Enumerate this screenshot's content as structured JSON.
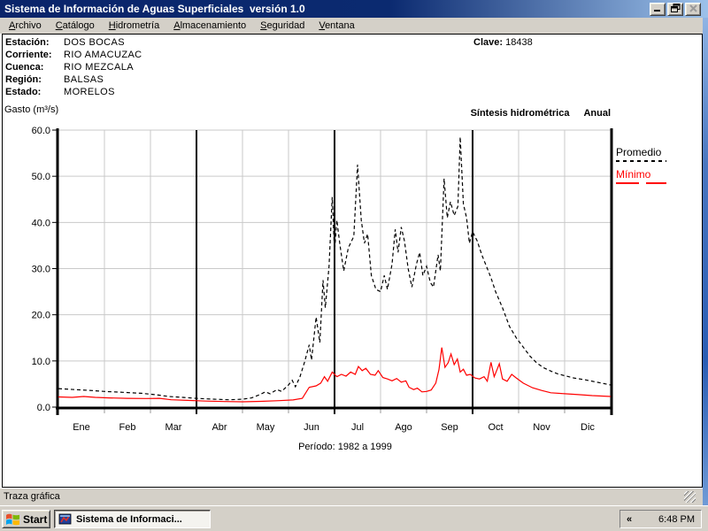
{
  "window": {
    "title": "Sistema de Información de Aguas Superficiales  versión 1.0"
  },
  "menu": {
    "items": [
      "Archivo",
      "Catálogo",
      "Hidrometría",
      "Almacenamiento",
      "Seguridad",
      "Ventana"
    ]
  },
  "station": {
    "fields": [
      {
        "label": "Estación:",
        "value": "DOS BOCAS"
      },
      {
        "label": "Corriente:",
        "value": "RIO AMACUZAC"
      },
      {
        "label": "Cuenca:",
        "value": "RIO MEZCALA"
      },
      {
        "label": "Región:",
        "value": "BALSAS"
      },
      {
        "label": "Estado:",
        "value": "MORELOS"
      }
    ],
    "clave_label": "Clave:",
    "clave_value": "18438"
  },
  "chart": {
    "ylabel": "Gasto (m³/s)",
    "title": "Síntesis hidrométrica",
    "subtitle": "Anual",
    "caption": "Período: 1982 a 1999"
  },
  "chart_data": {
    "type": "line",
    "title": "Síntesis hidrométrica Anual",
    "ylabel": "Gasto (m³/s)",
    "xlabel": "",
    "caption": "Período: 1982 a 1999",
    "categories": [
      "Ene",
      "Feb",
      "Mar",
      "Abr",
      "May",
      "Jun",
      "Jul",
      "Ago",
      "Sep",
      "Oct",
      "Nov",
      "Dic"
    ],
    "ylim": [
      0,
      60
    ],
    "ytick_step": 10,
    "ytick_labels": [
      "0.0",
      "10.0",
      "20.0",
      "30.0",
      "40.0",
      "50.0",
      "60.0"
    ],
    "grid": true,
    "quarter_divider_months": [
      3,
      6,
      9
    ],
    "legend_position": "right",
    "x_units": "month fraction 0-12",
    "series": [
      {
        "name": "Promedio",
        "color": "#000000",
        "style": "dashed",
        "points": [
          [
            0,
            4.0
          ],
          [
            0.35,
            3.8
          ],
          [
            0.7,
            3.6
          ],
          [
            1.0,
            3.4
          ],
          [
            1.4,
            3.2
          ],
          [
            1.8,
            3.0
          ],
          [
            2.1,
            2.7
          ],
          [
            2.4,
            2.3
          ],
          [
            2.7,
            2.1
          ],
          [
            3.0,
            1.9
          ],
          [
            3.3,
            1.75
          ],
          [
            3.7,
            1.6
          ],
          [
            4.0,
            1.7
          ],
          [
            4.2,
            2.0
          ],
          [
            4.35,
            2.6
          ],
          [
            4.5,
            3.3
          ],
          [
            4.6,
            2.9
          ],
          [
            4.75,
            3.8
          ],
          [
            4.85,
            3.4
          ],
          [
            5.0,
            4.8
          ],
          [
            5.08,
            5.8
          ],
          [
            5.15,
            4.4
          ],
          [
            5.25,
            6.6
          ],
          [
            5.35,
            9.8
          ],
          [
            5.45,
            13.5
          ],
          [
            5.5,
            10.2
          ],
          [
            5.6,
            19.5
          ],
          [
            5.68,
            14.0
          ],
          [
            5.75,
            27.5
          ],
          [
            5.8,
            21.5
          ],
          [
            5.88,
            30.5
          ],
          [
            5.95,
            45.5
          ],
          [
            6.0,
            33.5
          ],
          [
            6.05,
            40.5
          ],
          [
            6.12,
            35.0
          ],
          [
            6.2,
            29.5
          ],
          [
            6.3,
            34.5
          ],
          [
            6.42,
            37.0
          ],
          [
            6.5,
            52.5
          ],
          [
            6.58,
            40.5
          ],
          [
            6.65,
            35.5
          ],
          [
            6.72,
            37.5
          ],
          [
            6.8,
            28.5
          ],
          [
            6.9,
            25.5
          ],
          [
            7.0,
            25.0
          ],
          [
            7.08,
            28.5
          ],
          [
            7.15,
            25.5
          ],
          [
            7.25,
            31.0
          ],
          [
            7.32,
            38.5
          ],
          [
            7.38,
            33.5
          ],
          [
            7.45,
            39.0
          ],
          [
            7.52,
            36.0
          ],
          [
            7.6,
            30.0
          ],
          [
            7.68,
            26.0
          ],
          [
            7.78,
            31.0
          ],
          [
            7.85,
            33.5
          ],
          [
            7.92,
            28.5
          ],
          [
            8.0,
            30.5
          ],
          [
            8.08,
            27.0
          ],
          [
            8.15,
            26.0
          ],
          [
            8.25,
            33.0
          ],
          [
            8.3,
            29.5
          ],
          [
            8.38,
            49.5
          ],
          [
            8.45,
            41.0
          ],
          [
            8.52,
            44.5
          ],
          [
            8.6,
            41.5
          ],
          [
            8.68,
            43.5
          ],
          [
            8.73,
            58.5
          ],
          [
            8.8,
            44.0
          ],
          [
            8.87,
            41.0
          ],
          [
            8.93,
            35.5
          ],
          [
            9.0,
            38.0
          ],
          [
            9.1,
            36.0
          ],
          [
            9.2,
            33.0
          ],
          [
            9.3,
            30.5
          ],
          [
            9.4,
            28.0
          ],
          [
            9.5,
            25.0
          ],
          [
            9.65,
            21.5
          ],
          [
            9.8,
            17.5
          ],
          [
            9.95,
            15.0
          ],
          [
            10.1,
            13.0
          ],
          [
            10.25,
            11.0
          ],
          [
            10.4,
            9.5
          ],
          [
            10.55,
            8.5
          ],
          [
            10.7,
            7.8
          ],
          [
            10.85,
            7.2
          ],
          [
            11.0,
            6.8
          ],
          [
            11.2,
            6.3
          ],
          [
            11.45,
            5.9
          ],
          [
            11.7,
            5.4
          ],
          [
            11.85,
            5.1
          ],
          [
            12,
            4.8
          ]
        ]
      },
      {
        "name": "Mínimo",
        "color": "#ff0000",
        "style": "solid",
        "points": [
          [
            0,
            2.2
          ],
          [
            0.3,
            2.1
          ],
          [
            0.55,
            2.3
          ],
          [
            0.8,
            2.1
          ],
          [
            1.1,
            2.0
          ],
          [
            1.5,
            1.9
          ],
          [
            1.9,
            1.85
          ],
          [
            2.2,
            1.9
          ],
          [
            2.45,
            1.6
          ],
          [
            2.8,
            1.45
          ],
          [
            3.2,
            1.3
          ],
          [
            3.6,
            1.2
          ],
          [
            4.0,
            1.15
          ],
          [
            4.4,
            1.25
          ],
          [
            4.8,
            1.4
          ],
          [
            5.1,
            1.55
          ],
          [
            5.3,
            1.9
          ],
          [
            5.45,
            4.3
          ],
          [
            5.6,
            4.6
          ],
          [
            5.7,
            5.2
          ],
          [
            5.78,
            6.6
          ],
          [
            5.85,
            5.6
          ],
          [
            5.95,
            7.6
          ],
          [
            6.05,
            6.6
          ],
          [
            6.15,
            7.1
          ],
          [
            6.25,
            6.7
          ],
          [
            6.35,
            7.6
          ],
          [
            6.45,
            7.1
          ],
          [
            6.52,
            8.8
          ],
          [
            6.6,
            7.9
          ],
          [
            6.68,
            8.4
          ],
          [
            6.78,
            7.1
          ],
          [
            6.88,
            6.9
          ],
          [
            6.95,
            7.9
          ],
          [
            7.05,
            6.4
          ],
          [
            7.15,
            6.1
          ],
          [
            7.25,
            5.7
          ],
          [
            7.35,
            6.2
          ],
          [
            7.45,
            5.4
          ],
          [
            7.55,
            5.7
          ],
          [
            7.62,
            4.3
          ],
          [
            7.72,
            3.8
          ],
          [
            7.8,
            4.1
          ],
          [
            7.9,
            3.3
          ],
          [
            8.0,
            3.4
          ],
          [
            8.1,
            3.7
          ],
          [
            8.2,
            5.2
          ],
          [
            8.27,
            8.1
          ],
          [
            8.33,
            12.9
          ],
          [
            8.4,
            8.6
          ],
          [
            8.47,
            9.6
          ],
          [
            8.53,
            11.5
          ],
          [
            8.6,
            9.2
          ],
          [
            8.67,
            10.4
          ],
          [
            8.73,
            7.6
          ],
          [
            8.8,
            8.2
          ],
          [
            8.87,
            6.9
          ],
          [
            8.95,
            7.1
          ],
          [
            9.05,
            6.3
          ],
          [
            9.15,
            6.1
          ],
          [
            9.25,
            6.6
          ],
          [
            9.32,
            5.6
          ],
          [
            9.4,
            9.7
          ],
          [
            9.47,
            6.6
          ],
          [
            9.53,
            8.1
          ],
          [
            9.58,
            9.4
          ],
          [
            9.65,
            6.1
          ],
          [
            9.75,
            5.6
          ],
          [
            9.85,
            7.1
          ],
          [
            9.95,
            6.3
          ],
          [
            10.1,
            5.2
          ],
          [
            10.3,
            4.2
          ],
          [
            10.5,
            3.6
          ],
          [
            10.7,
            3.1
          ],
          [
            11.0,
            2.9
          ],
          [
            11.3,
            2.7
          ],
          [
            11.6,
            2.5
          ],
          [
            12,
            2.3
          ]
        ]
      }
    ]
  },
  "status_bar": {
    "text": "Traza gráfica"
  },
  "taskbar": {
    "start_label": "Start",
    "tasks": [
      {
        "label": "Sistema de Informaci...",
        "active": true
      }
    ],
    "tray": {
      "chevron": "«",
      "clock": "6:48 PM"
    }
  }
}
